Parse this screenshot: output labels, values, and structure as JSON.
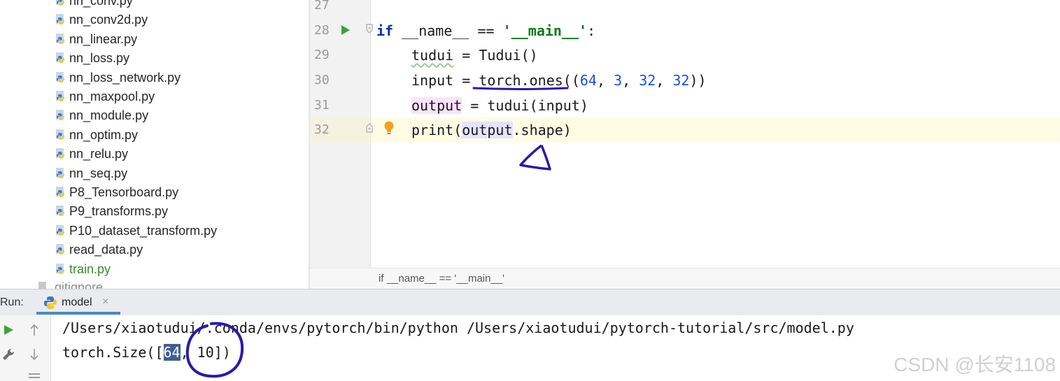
{
  "project_tree": {
    "items": [
      {
        "label": "nn_conv.py",
        "active": false
      },
      {
        "label": "nn_conv2d.py",
        "active": false
      },
      {
        "label": "nn_linear.py",
        "active": false
      },
      {
        "label": "nn_loss.py",
        "active": false
      },
      {
        "label": "nn_loss_network.py",
        "active": false
      },
      {
        "label": "nn_maxpool.py",
        "active": false
      },
      {
        "label": "nn_module.py",
        "active": false
      },
      {
        "label": "nn_optim.py",
        "active": false
      },
      {
        "label": "nn_relu.py",
        "active": false
      },
      {
        "label": "nn_seq.py",
        "active": false
      },
      {
        "label": "P8_Tensorboard.py",
        "active": false
      },
      {
        "label": "P9_transforms.py",
        "active": false
      },
      {
        "label": "P10_dataset_transform.py",
        "active": false
      },
      {
        "label": "read_data.py",
        "active": false
      },
      {
        "label": "train.py",
        "active": true
      }
    ],
    "gitignore": ".gitignore"
  },
  "editor": {
    "lines": [
      {
        "number": "27"
      },
      {
        "number": "28",
        "kw": "if",
        "var": "__name__",
        "op": "==",
        "str": "'__main__'",
        "end": ":"
      },
      {
        "number": "29",
        "var": "tudui",
        "op": "=",
        "rhs": "Tudui()"
      },
      {
        "number": "30",
        "var": "input",
        "op": "=",
        "call": "torch.ones",
        "open": "((",
        "n1": "64",
        "n2": "3",
        "n3": "32",
        "n4": "32",
        "close": "))"
      },
      {
        "number": "31",
        "var": "output",
        "op": "=",
        "rhs": "tudui(input)"
      },
      {
        "number": "32",
        "fn": "print(",
        "arg": "output",
        "attr": ".shape)"
      }
    ],
    "breadcrumb": "if __name__ == '__main__'"
  },
  "run_panel": {
    "label": "Run:",
    "tab": {
      "name": "model",
      "close": "×"
    },
    "console": {
      "command": "/Users/xiaotudui/.conda/envs/pytorch/bin/python /Users/xiaotudui/pytorch-tutorial/src/model.py",
      "output_prefix": "torch.Size([",
      "output_selected": "64",
      "output_suffix": ", 10])"
    }
  },
  "watermark": "CSDN @长安1108",
  "colors": {
    "keyword": "#0033b3",
    "string": "#067d17",
    "number": "#1750eb",
    "annotation_ink": "#2a1aa8",
    "run_green": "#3aa53a"
  },
  "icons": [
    "python-file-icon",
    "run-gutter-icon",
    "fold-icon",
    "bulb-icon",
    "python-logo-icon",
    "run-icon",
    "scroll-up-icon",
    "scroll-down-icon",
    "wrench-icon",
    "menu-icon"
  ]
}
